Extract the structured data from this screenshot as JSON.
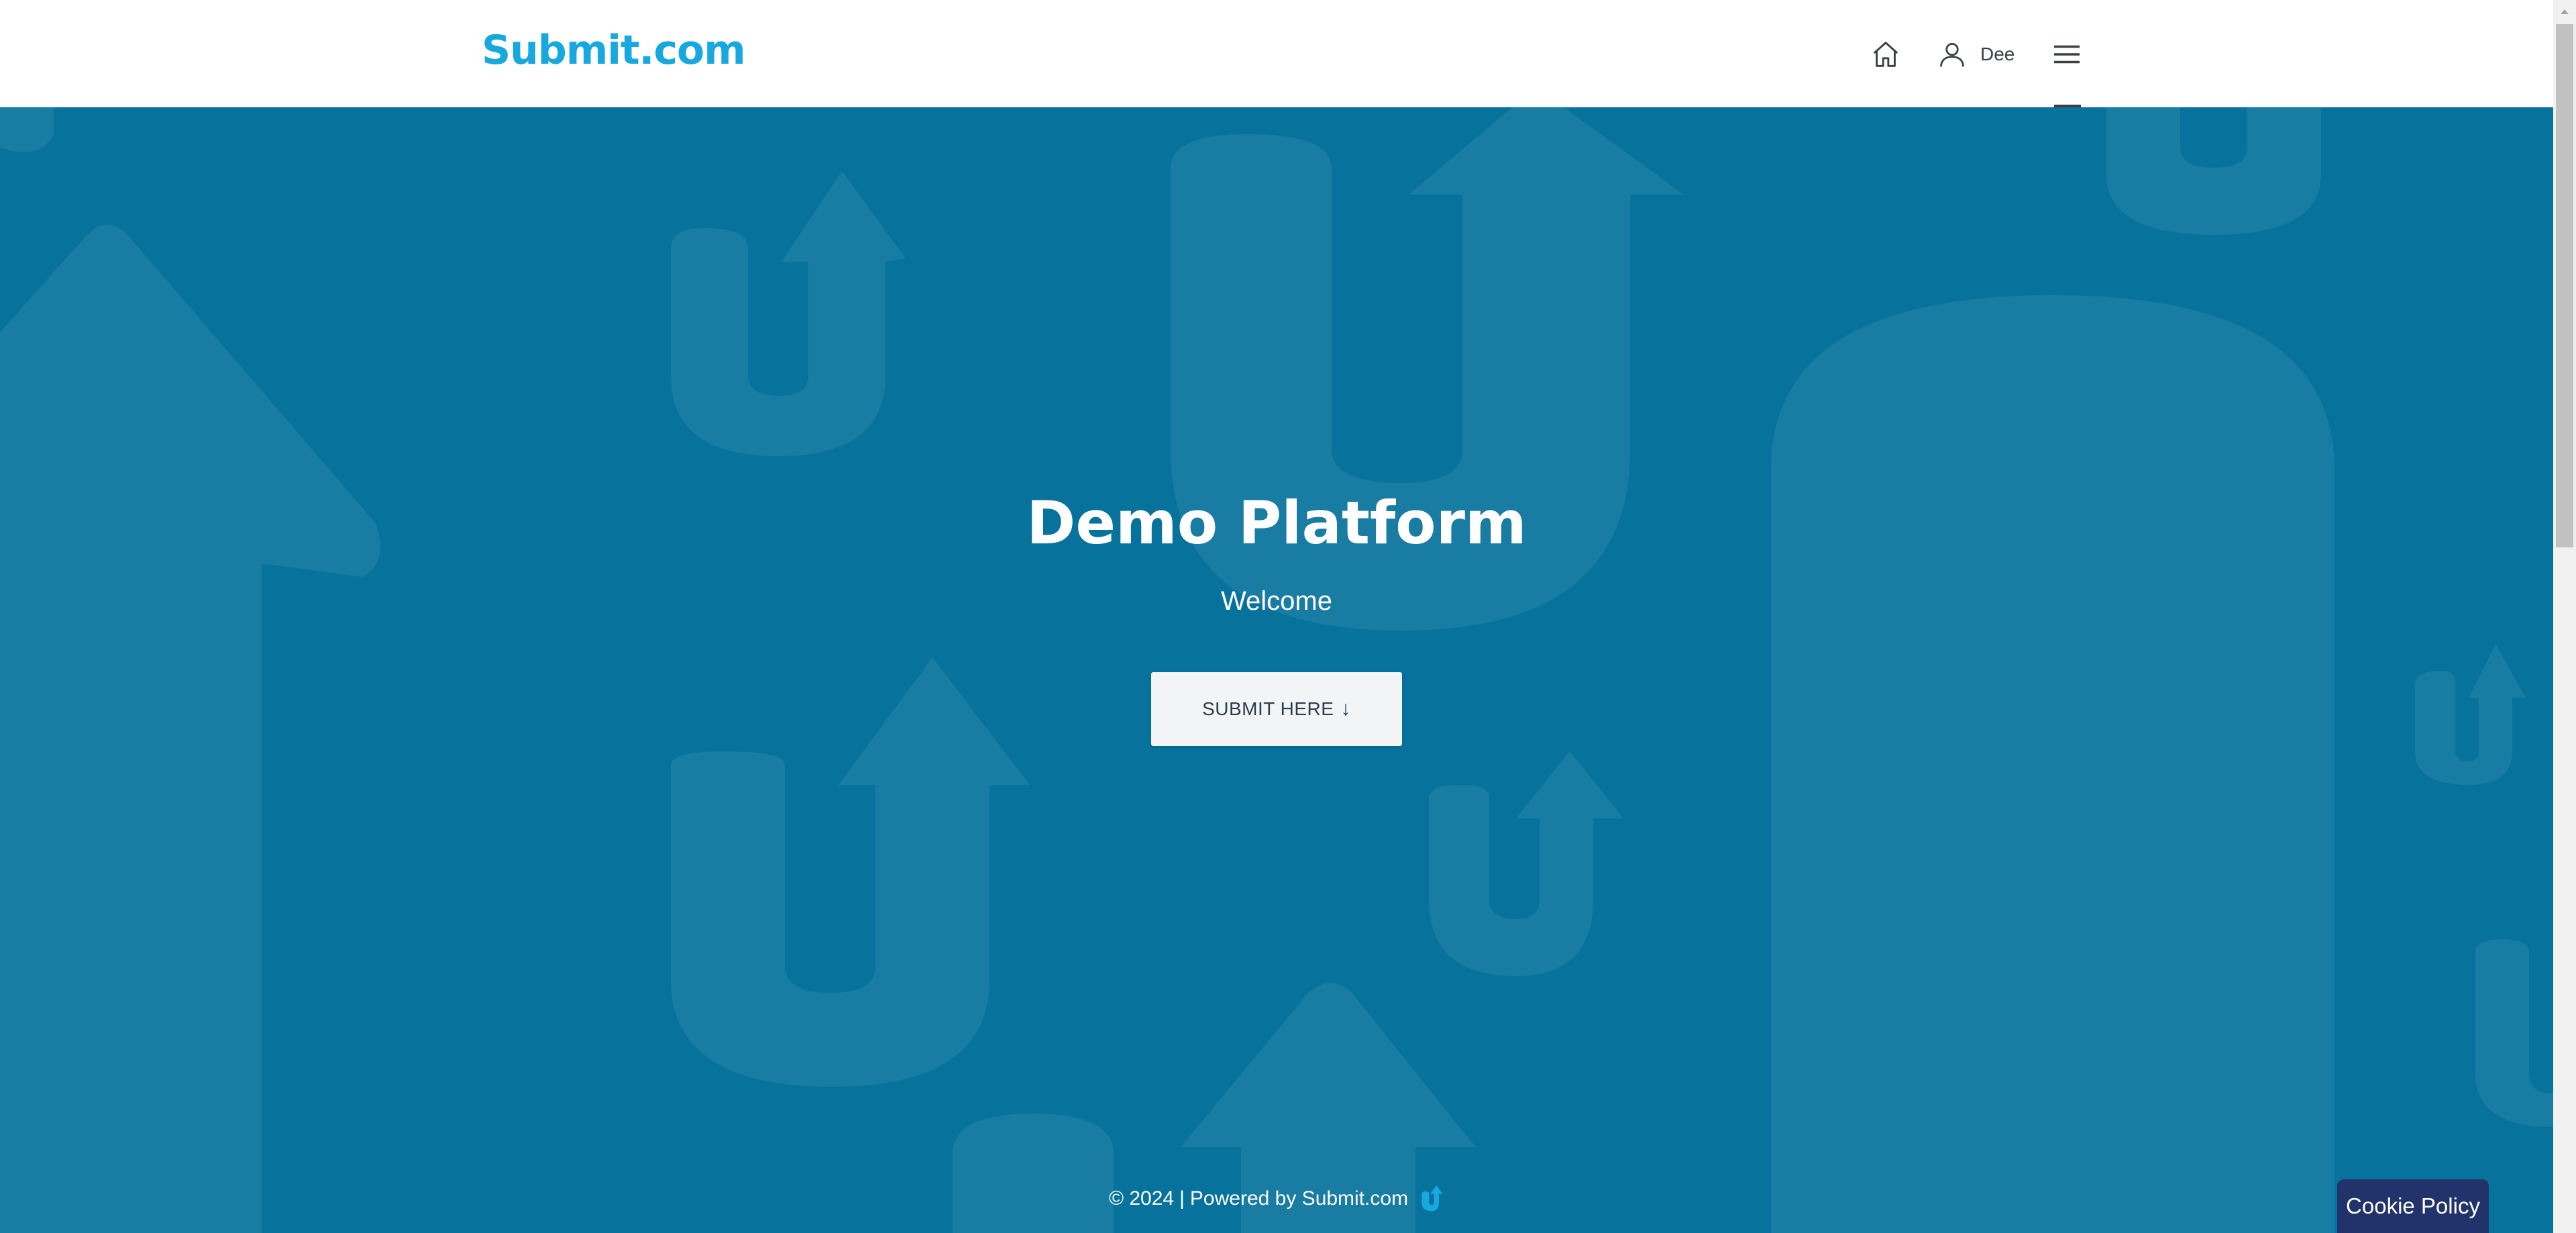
{
  "header": {
    "logo_text": "Submit.com",
    "user_name": "Dee",
    "icons": {
      "home": "home-icon",
      "user": "user-icon",
      "menu": "hamburger-menu-icon"
    }
  },
  "hero": {
    "title": "Demo Platform",
    "subtitle": "Welcome",
    "button_label": "SUBMIT HERE",
    "button_icon": "↓"
  },
  "footer": {
    "copyright": "© 2024",
    "separator": "|",
    "powered_by": "Powered by Submit.com"
  },
  "cookie": {
    "label": "Cookie Policy"
  },
  "colors": {
    "background": "#07739c",
    "logo": "#16a8de",
    "cookie_bg": "#22336b",
    "button_bg": "#f2f4f5"
  }
}
